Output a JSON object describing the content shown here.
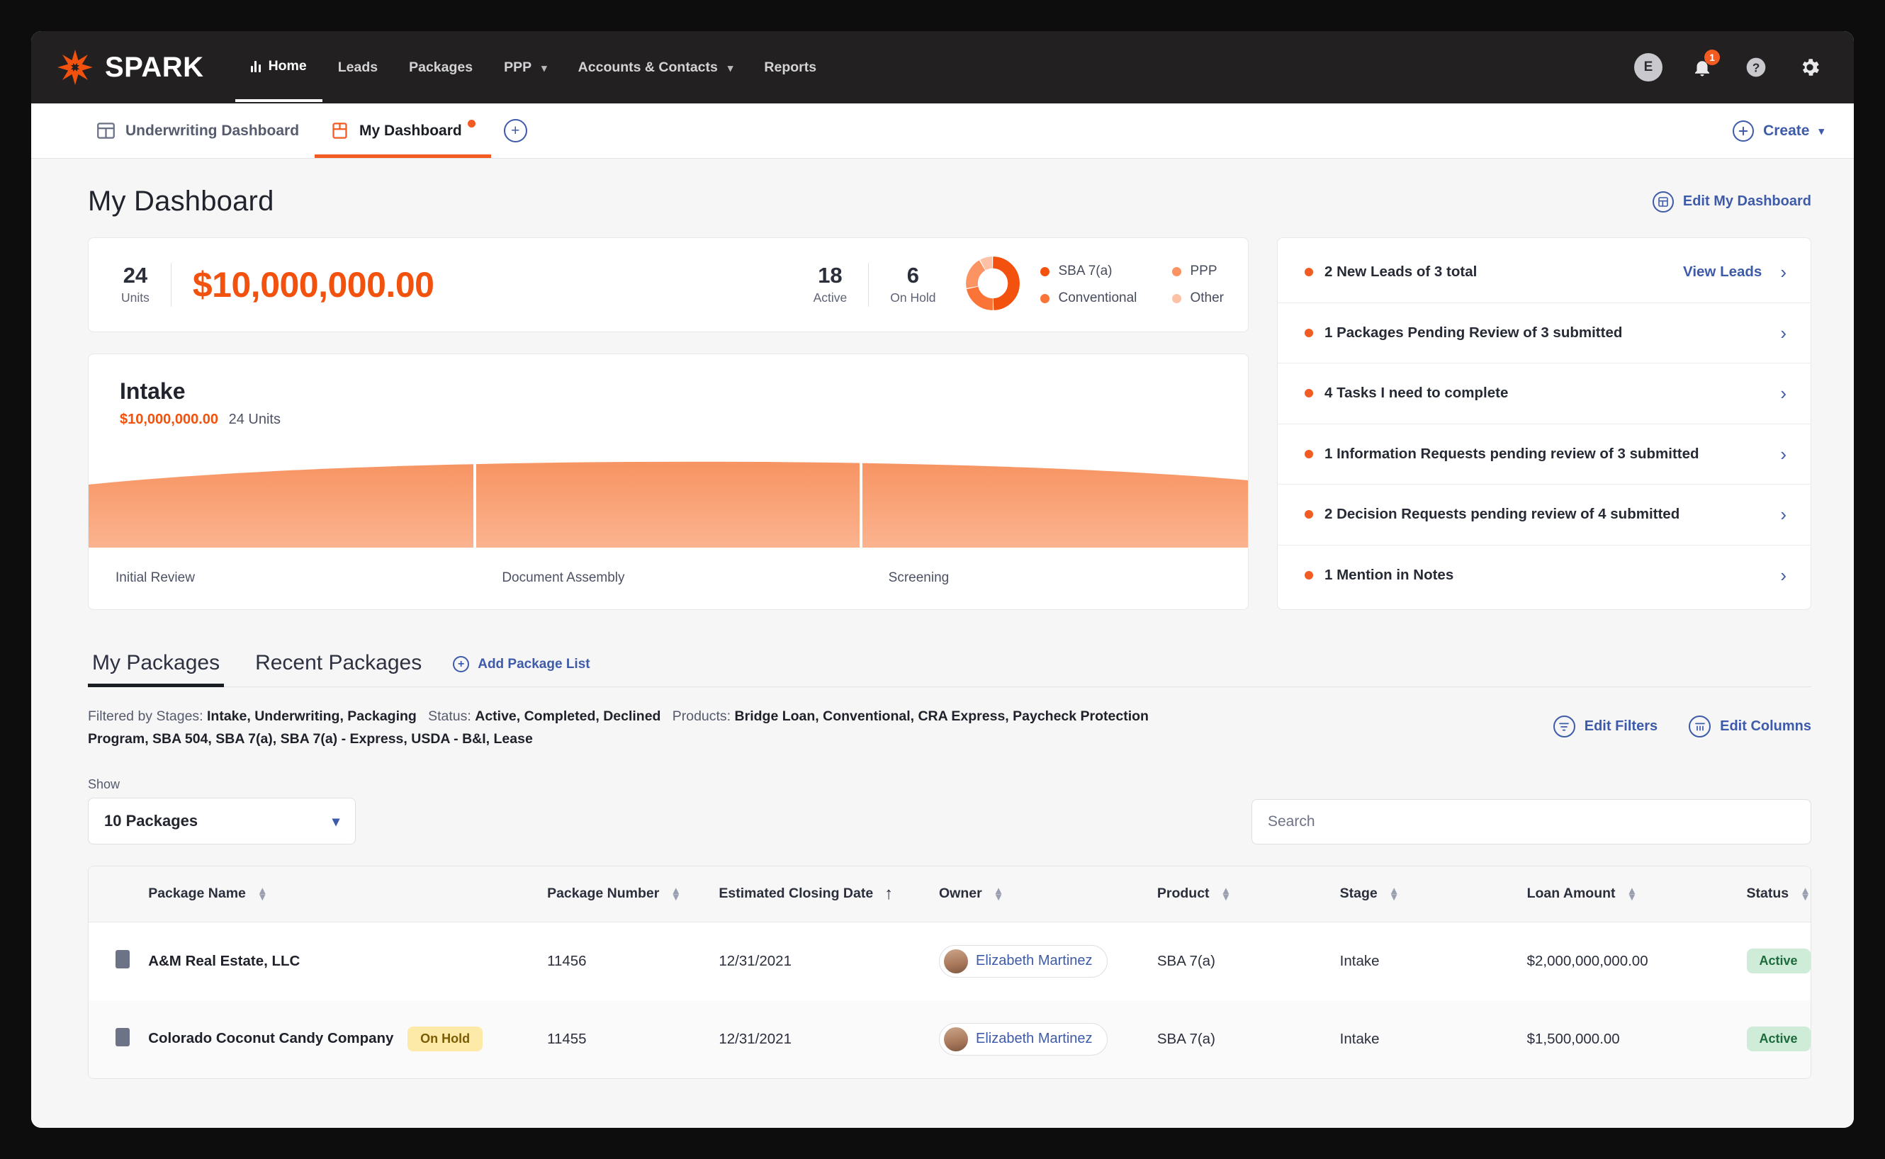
{
  "brand": {
    "name": "SPARK"
  },
  "topnav": {
    "items": [
      {
        "label": "Home",
        "icon": "bar-chart-icon",
        "active": true,
        "caret": false
      },
      {
        "label": "Leads",
        "active": false,
        "caret": false
      },
      {
        "label": "Packages",
        "active": false,
        "caret": false
      },
      {
        "label": "PPP",
        "active": false,
        "caret": true
      },
      {
        "label": "Accounts & Contacts",
        "active": false,
        "caret": true
      },
      {
        "label": "Reports",
        "active": false,
        "caret": false
      }
    ],
    "avatar_initial": "E",
    "notification_count": "1",
    "help_label": "?",
    "icons": [
      "user-avatar-icon",
      "bell-icon",
      "help-icon",
      "gear-icon"
    ]
  },
  "dashboard_tabs": {
    "tabs": [
      {
        "label": "Underwriting Dashboard",
        "icon": "grid-dashboard-icon",
        "active": false,
        "dot": false
      },
      {
        "label": "My Dashboard",
        "icon": "panel-dashboard-icon",
        "active": true,
        "dot": true
      }
    ],
    "add_label": "+",
    "create_label": "Create"
  },
  "page": {
    "title": "My Dashboard",
    "edit_dashboard": "Edit My Dashboard"
  },
  "summary": {
    "units_value": "24",
    "units_label": "Units",
    "amount": "$10,000,000.00",
    "active_value": "18",
    "active_label": "Active",
    "onhold_value": "6",
    "onhold_label": "On Hold"
  },
  "chart_data": [
    {
      "type": "pie",
      "title": "Product mix",
      "legend_position": "right",
      "categories": [
        "SBA 7(a)",
        "Conventional",
        "PPP",
        "Other"
      ],
      "values": [
        50,
        22,
        20,
        8
      ],
      "colors": [
        "#F2520E",
        "#FA7337",
        "#FB9362",
        "#FDC2A5"
      ]
    },
    {
      "type": "area",
      "title": "Intake",
      "subtitle_amount": "$10,000,000.00",
      "subtitle_units": "24 Units",
      "categories": [
        "Initial Review",
        "Document Assembly",
        "Screening"
      ],
      "values": [
        100,
        118,
        112
      ],
      "ylabel": "",
      "xlabel": "",
      "grid": false,
      "fill_color": "#F9A77D"
    }
  ],
  "notifications": [
    {
      "text": "2 New Leads of 3 total",
      "link": "View Leads"
    },
    {
      "text": "1 Packages Pending Review of 3 submitted",
      "link": ""
    },
    {
      "text": "4 Tasks I need to complete",
      "link": ""
    },
    {
      "text": "1 Information Requests pending review of 3 submitted",
      "link": ""
    },
    {
      "text": "2 Decision Requests pending review of 4 submitted",
      "link": ""
    },
    {
      "text": "1 Mention in Notes",
      "link": ""
    }
  ],
  "packages": {
    "tabs": [
      {
        "label": "My Packages",
        "active": true
      },
      {
        "label": "Recent Packages",
        "active": false
      }
    ],
    "add_list_label": "Add Package List",
    "filters_prefix": "Filtered by Stages:",
    "filters_stages": "Intake, Underwriting, Packaging",
    "filters_status_label": "Status:",
    "filters_status": "Active, Completed, Declined",
    "filters_products_label": "Products:",
    "filters_products": "Bridge Loan, Conventional, CRA Express, Paycheck Protection Program, SBA 504, SBA 7(a), SBA 7(a) - Express, USDA - B&I, Lease",
    "edit_filters": "Edit Filters",
    "edit_columns": "Edit Columns",
    "show_label": "Show",
    "show_value": "10 Packages",
    "search_placeholder": "Search",
    "search_value": "",
    "columns": [
      {
        "label": "Package Name",
        "sort": "none"
      },
      {
        "label": "Package Number",
        "sort": "none"
      },
      {
        "label": "Estimated Closing Date",
        "sort": "asc"
      },
      {
        "label": "Owner",
        "sort": "none"
      },
      {
        "label": "Product",
        "sort": "none"
      },
      {
        "label": "Stage",
        "sort": "none"
      },
      {
        "label": "Loan Amount",
        "sort": "none"
      },
      {
        "label": "Status",
        "sort": "none"
      }
    ],
    "rows": [
      {
        "name": "A&M Real Estate, LLC",
        "name_badge": "",
        "number": "11456",
        "closing_date": "12/31/2021",
        "owner": "Elizabeth Martinez",
        "product": "SBA 7(a)",
        "stage": "Intake",
        "amount": "$2,000,000,000.00",
        "status": "Active"
      },
      {
        "name": "Colorado Coconut Candy Company",
        "name_badge": "On Hold",
        "number": "11455",
        "closing_date": "12/31/2021",
        "owner": "Elizabeth Martinez",
        "product": "SBA 7(a)",
        "stage": "Intake",
        "amount": "$1,500,000.00",
        "status": "Active"
      }
    ]
  }
}
